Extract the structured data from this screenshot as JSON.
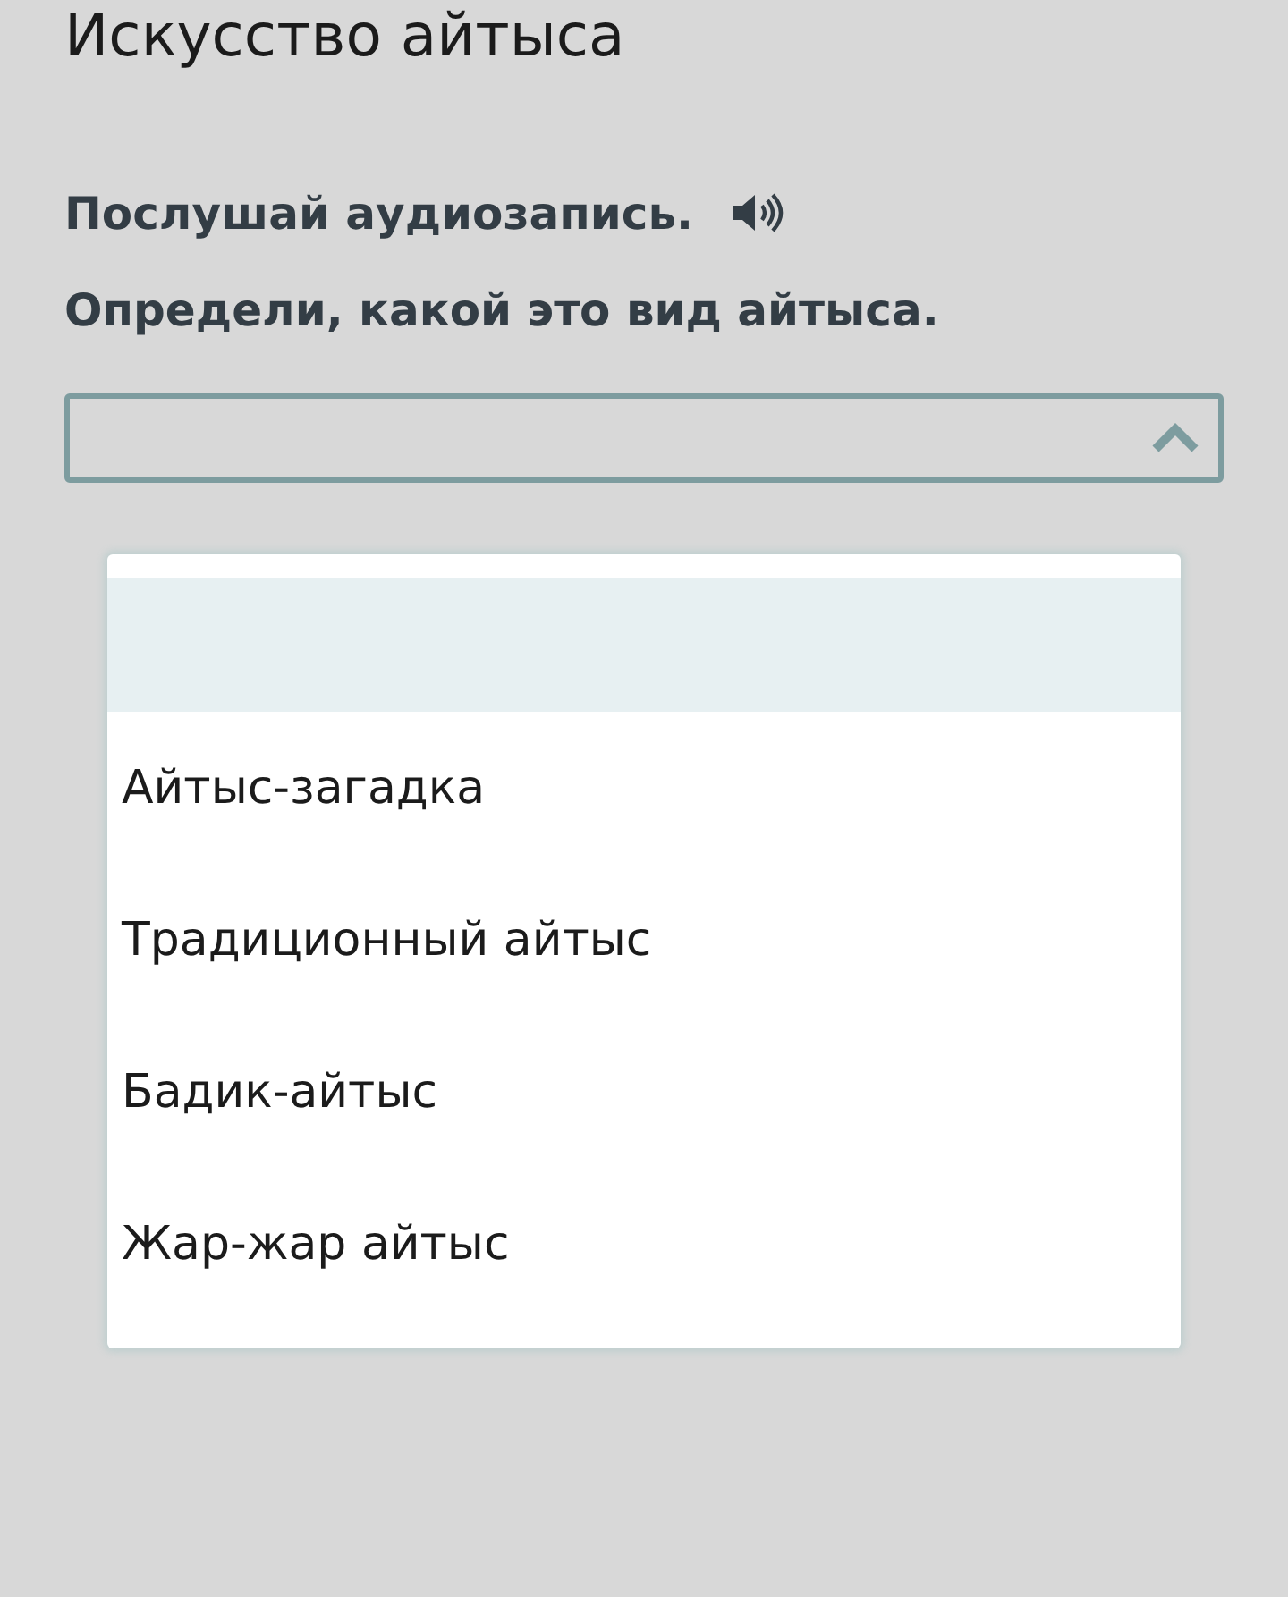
{
  "title": "Искусство айтыса",
  "instructions": [
    {
      "text": "Послушай аудиозапись.",
      "audio": true
    },
    {
      "text": "Определи, какой это вид айтыса.",
      "audio": false
    }
  ],
  "select": {
    "expanded": true
  },
  "options": [
    {
      "selected": true
    },
    {
      "label": "Айтыс-загадка",
      "selected": false
    },
    {
      "label": "Традиционный айтыс",
      "selected": false
    },
    {
      "label": "Бадик-айтыс",
      "selected": false
    },
    {
      "label": "Жар-жар айтыс",
      "selected": false
    }
  ]
}
